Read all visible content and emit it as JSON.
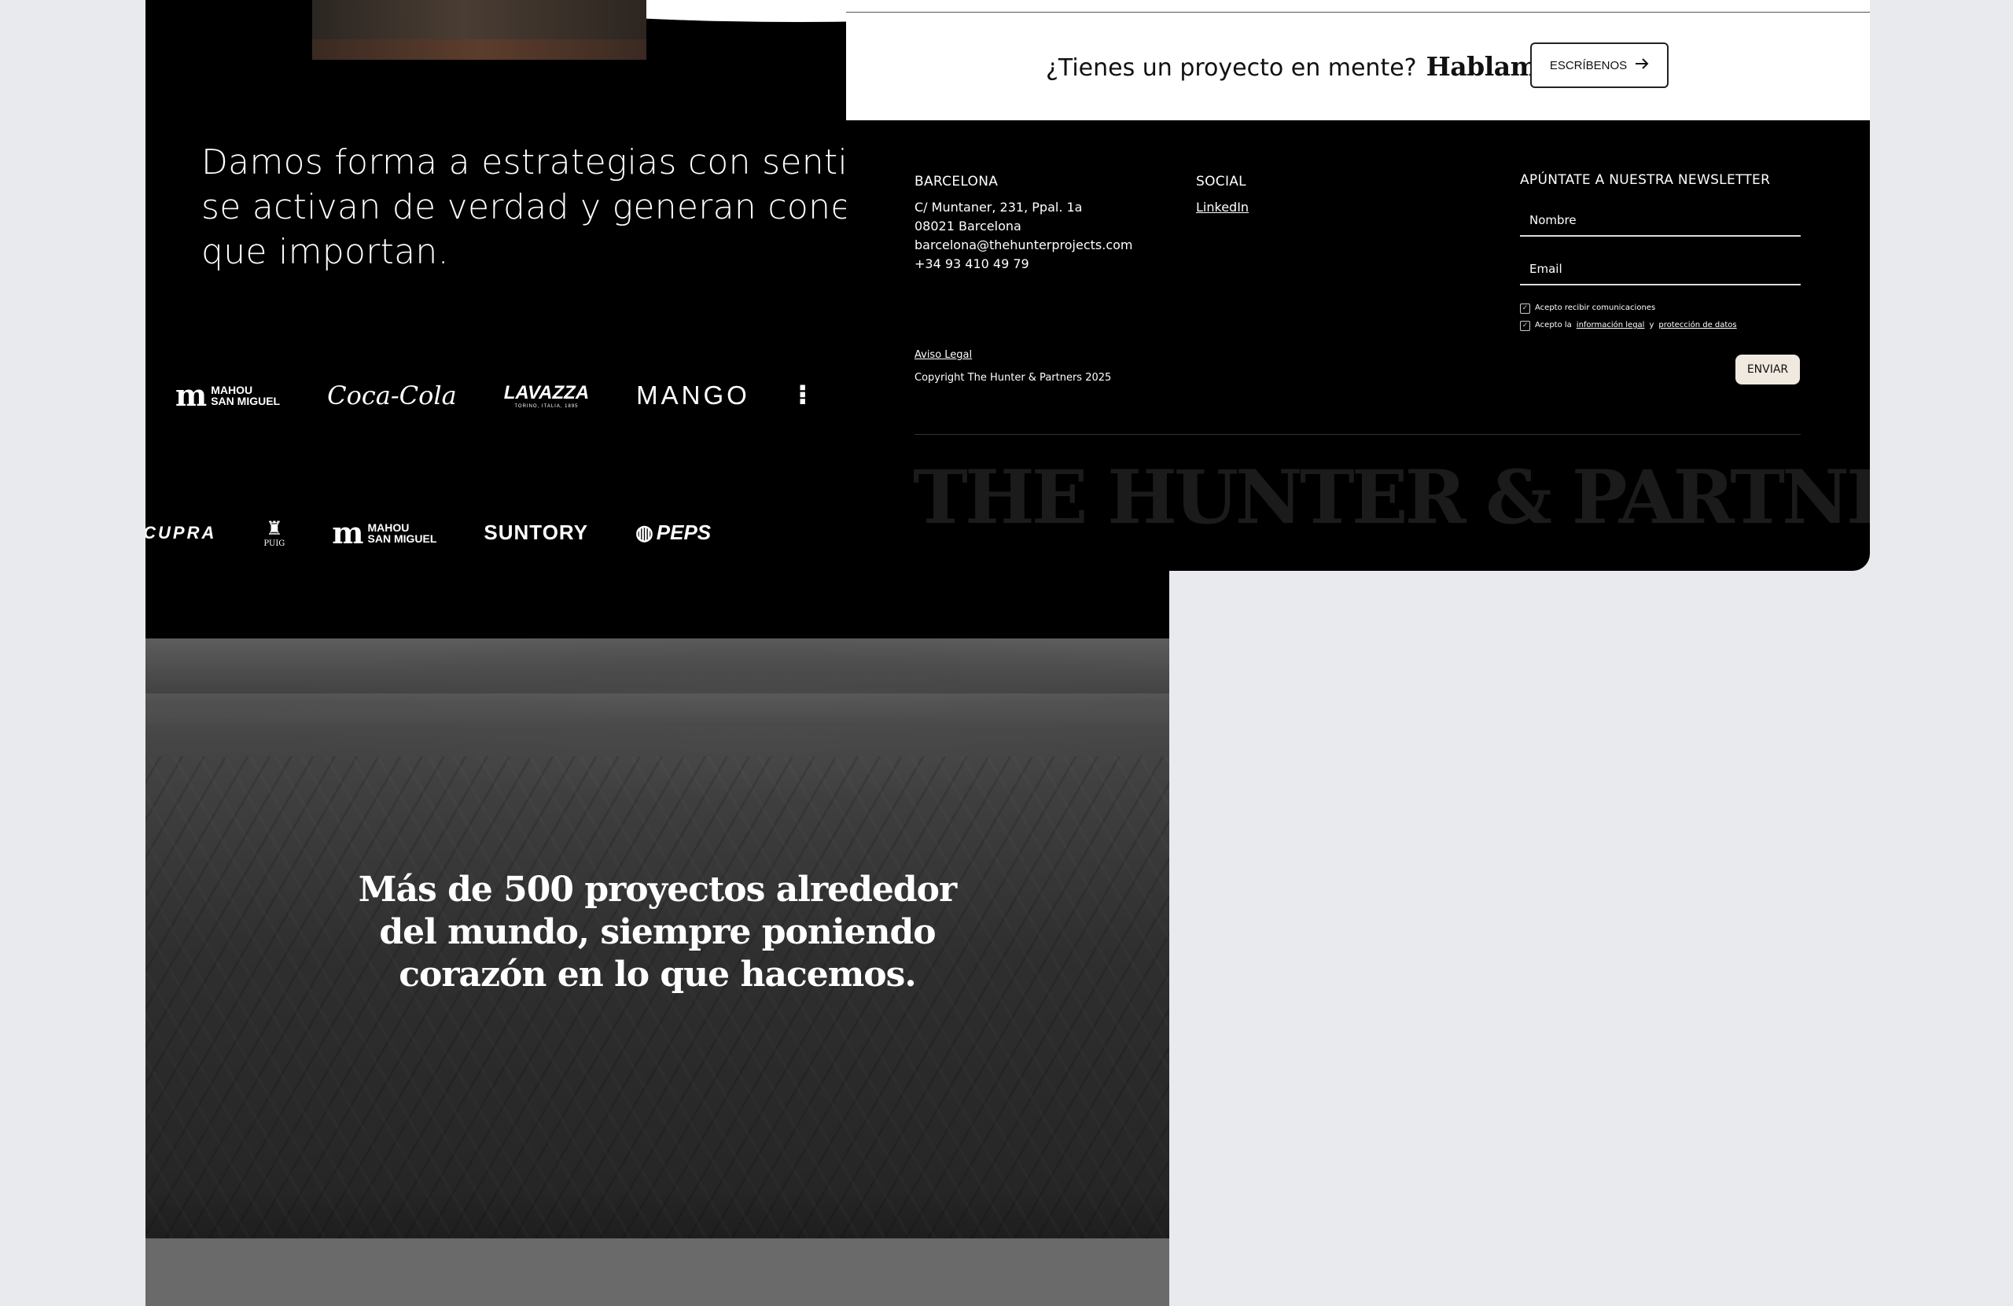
{
  "intro": {
    "tagline_lines": [
      "Damos forma a estrategias con sentido, que",
      "se activan de verdad y generan conexiones",
      "que importan."
    ]
  },
  "logos": {
    "row1": [
      "mahou-san-miguel",
      "coca-cola",
      "lavazza",
      "mango",
      "partial-logo"
    ],
    "row2": [
      "cupra",
      "puig",
      "mahou-san-miguel",
      "suntory",
      "pepsi"
    ],
    "mahou_lines": [
      "MAHOU",
      "SAN MIGUEL"
    ],
    "coca_cola": "Coca-Cola",
    "lavazza": "LAVAZZA",
    "lavazza_sub": "TORINO, ITALIA, 1895",
    "mango": "MANGO",
    "cupra": "CUPRA",
    "puig": "PUIG",
    "suntory": "SUNTORY",
    "pepsi": "PEPS"
  },
  "city": {
    "headline_lines": [
      "Más de 500 proyectos alrededor",
      "del mundo, siempre poniendo",
      "corazón en lo que hacemos."
    ]
  },
  "cta": {
    "question": "¿Tienes un proyecto en mente?",
    "emphasis": "Hablamos",
    "button_label": "ESCRÍBENOS",
    "button_icon": "arrow-right-icon"
  },
  "footer": {
    "barcelona": {
      "heading": "BARCELONA",
      "address_line1": "C/ Muntaner, 231, Ppal. 1a",
      "address_line2": "08021 Barcelona",
      "email": "barcelona@thehunterprojects.com",
      "phone": "+34 93 410 49 79"
    },
    "social": {
      "heading": "SOCIAL",
      "linkedin": "LinkedIn"
    },
    "legal": {
      "aviso": "Aviso Legal",
      "copyright": "Copyright The Hunter & Partners 2025"
    },
    "newsletter": {
      "heading": "APÚNTATE A NUESTRA NEWSLETTER",
      "name_placeholder": "Nombre",
      "email_placeholder": "Email",
      "consent_comms": "Acepto recibir comunicaciones",
      "consent_legal_prefix": "Acepto la",
      "consent_legal_link1": "información legal",
      "consent_legal_and": "y",
      "consent_legal_link2": "protección de datos",
      "submit_label": "ENVIAR"
    },
    "wordmark": "THE HUNTER & PARTNERS"
  },
  "colors": {
    "page_bg": "#e9eaee",
    "panel_bg": "#000000",
    "submit_bg": "#efe9df",
    "wordmark": "#1b1b1b"
  }
}
